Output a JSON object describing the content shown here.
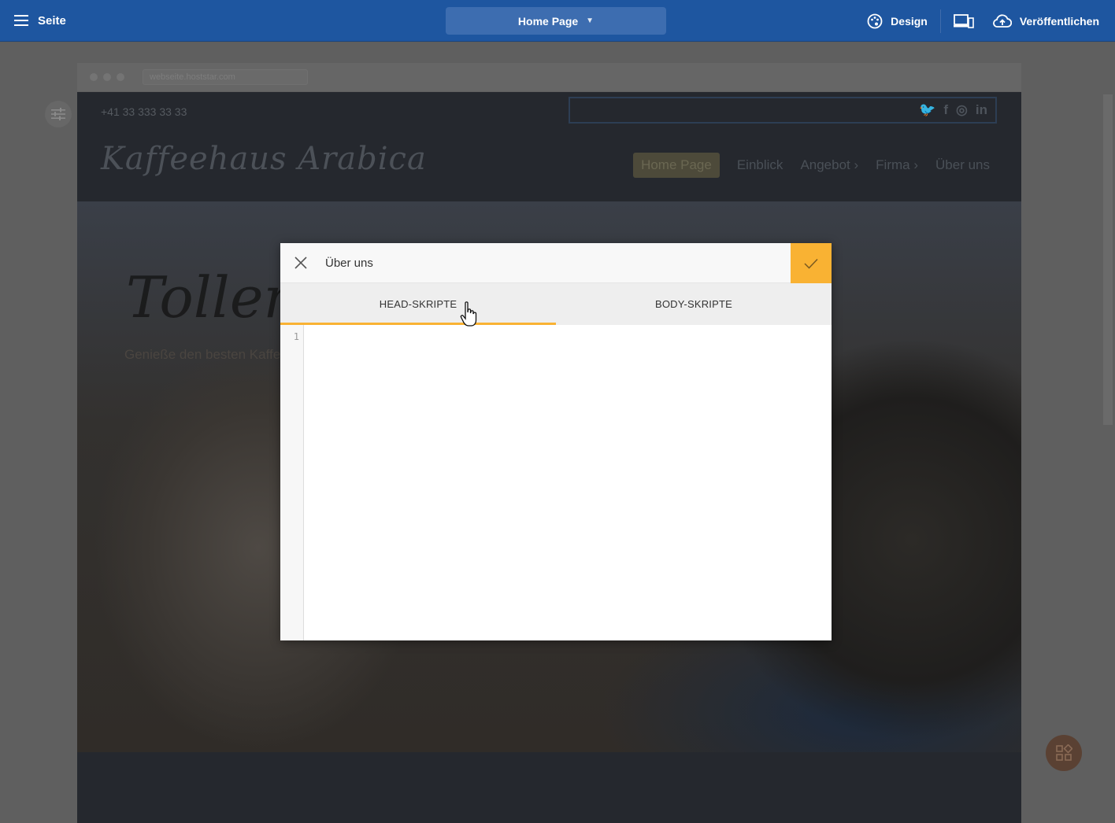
{
  "toolbar": {
    "menu_label": "Seite",
    "page_select": "Home Page",
    "design_label": "Design",
    "publish_label": "Veröffentlichen"
  },
  "browser": {
    "url": "webseite.hoststar.com"
  },
  "site": {
    "phone": "+41 33 333 33 33",
    "logo": "Kaffeehaus Arabica",
    "nav": [
      "Home Page",
      "Einblick",
      "Angebot",
      "Firma",
      "Über uns"
    ],
    "hero_title": "Toller S",
    "hero_subtitle": "Genieße den besten Kaffe"
  },
  "modal": {
    "title": "Über uns",
    "tabs": [
      "HEAD-SKRIPTE",
      "BODY-SKRIPTE"
    ],
    "active_tab": "HEAD-SKRIPTE",
    "line_numbers": [
      "1"
    ]
  },
  "colors": {
    "toolbar": "#1e56a0",
    "accent": "#f9b233"
  }
}
